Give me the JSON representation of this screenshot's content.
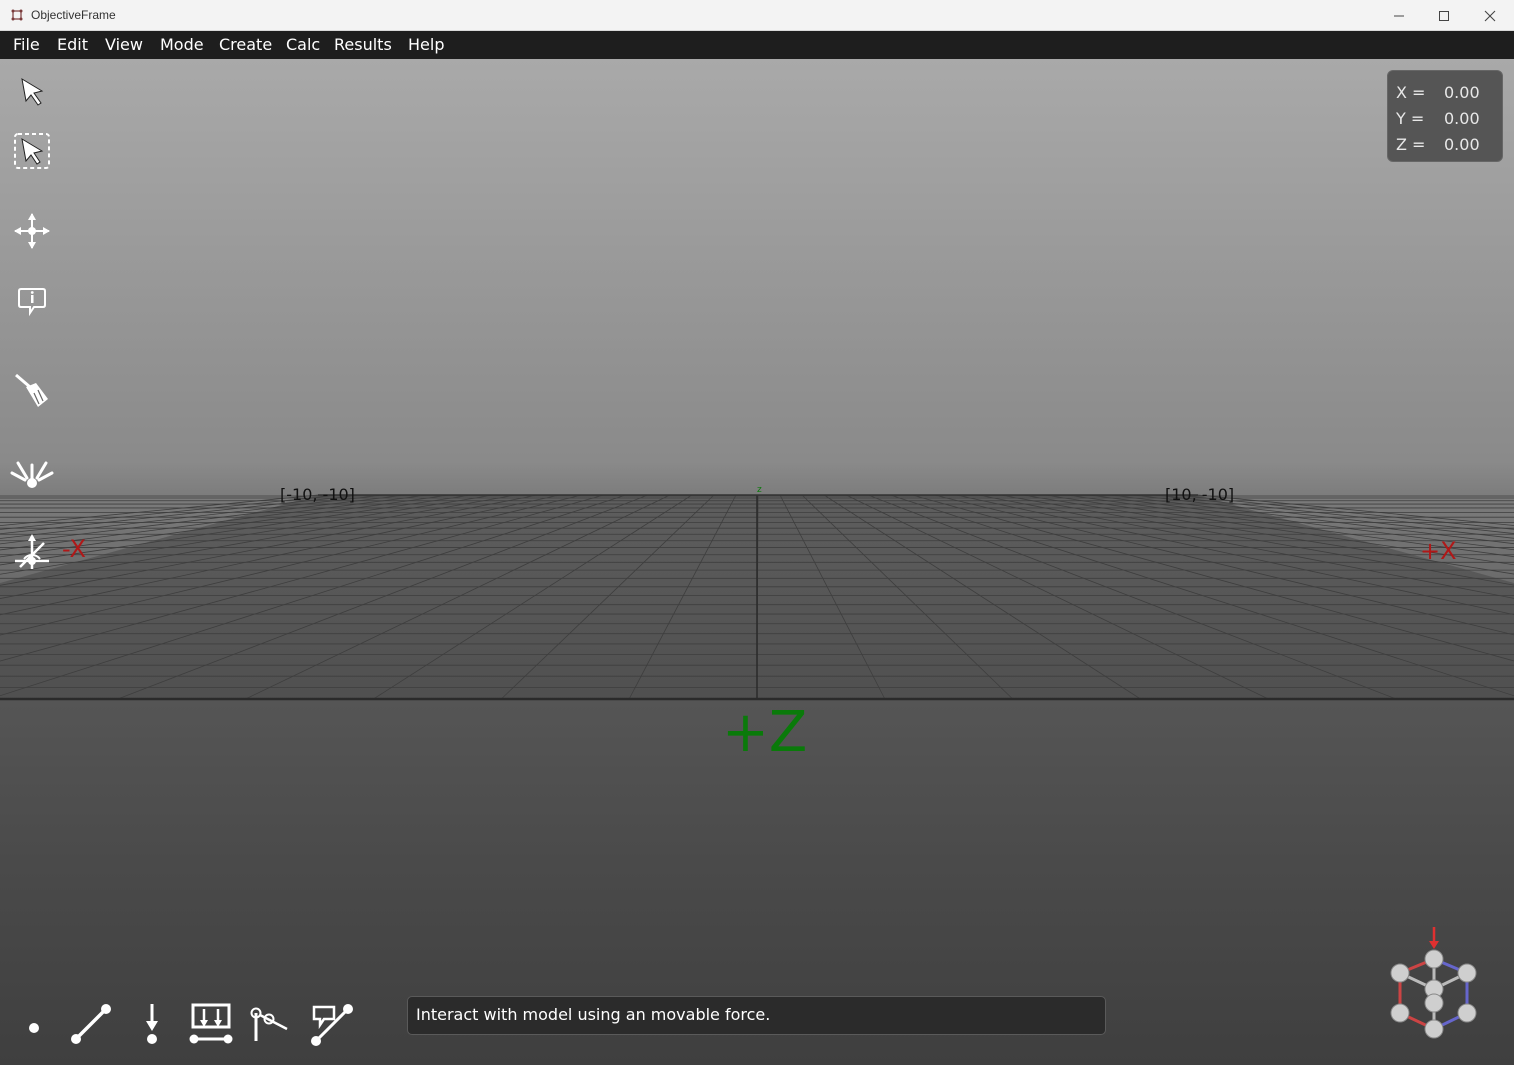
{
  "window": {
    "title": "ObjectiveFrame"
  },
  "menu": {
    "items": [
      "File",
      "Edit",
      "View",
      "Mode",
      "Create",
      "Calc",
      "Results",
      "Help"
    ]
  },
  "coords": {
    "x_label": "X =",
    "x_value": "0.00",
    "y_label": "Y =",
    "y_value": "0.00",
    "z_label": "Z =",
    "z_value": "0.00"
  },
  "axes": {
    "neg_x": "-X",
    "pos_x": "+X",
    "pos_z": "+Z",
    "z_small": "z"
  },
  "grid_labels": {
    "back_left": "[-10, -10]",
    "back_right": "[10, -10]"
  },
  "colors": {
    "axis_x": "#b01818",
    "axis_z": "#0a7a0a",
    "menubar": "#1e1e1e",
    "viewport_top": "#a9a9a9"
  },
  "left_toolbar": [
    "select-arrow-icon",
    "box-select-icon",
    "move-icon",
    "info-icon",
    "clear-brush-icon",
    "inspect-icon",
    "gizmo-icon"
  ],
  "bottom_toolbar": [
    "create-node-icon",
    "create-beam-icon",
    "node-force-icon",
    "distributed-load-icon",
    "node-bc-icon",
    "beam-load-icon"
  ],
  "status": {
    "message": "Interact with model using an movable force."
  }
}
